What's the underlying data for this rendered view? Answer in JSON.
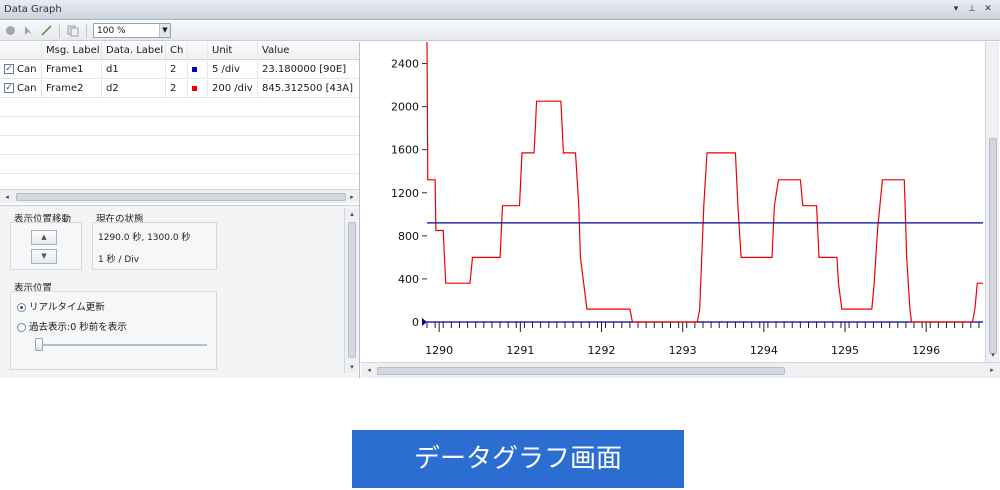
{
  "window": {
    "title": "Data Graph"
  },
  "toolbar": {
    "zoom_value": "100 %"
  },
  "table": {
    "columns": [
      "Msg. Label",
      "Data. Label",
      "Ch",
      "Unit",
      "Value"
    ],
    "rows": [
      {
        "checked": true,
        "bus": "Can",
        "msg": "Frame1",
        "data": "d1",
        "ch": "2",
        "color": "#0000cc",
        "unit": "5 /div",
        "value": "23.180000 [90E]"
      },
      {
        "checked": true,
        "bus": "Can",
        "msg": "Frame2",
        "data": "d2",
        "ch": "2",
        "color": "#ee0000",
        "unit": "200 /div",
        "value": "845.312500 [43A]"
      }
    ]
  },
  "controls": {
    "move_group_label": "表示位置移動",
    "state_group_label": "現在の状態",
    "state_range": "1290.0 秒, 1300.0 秒",
    "state_div": "1 秒 / Div",
    "position_group_label": "表示位置",
    "realtime_option": "リアルタイム更新",
    "past_option": "過去表示:0 秒前を表示"
  },
  "chart_data": {
    "type": "line",
    "xlim": [
      1289.85,
      1296.7
    ],
    "ylim": [
      0,
      2600
    ],
    "x_ticks": [
      "1290",
      "1291",
      "1292",
      "1293",
      "1294",
      "1295",
      "1296"
    ],
    "y_ticks": [
      "0",
      "400",
      "800",
      "1200",
      "1600",
      "2000",
      "2400"
    ],
    "series": [
      {
        "color": "#ee0000",
        "points": [
          [
            1289.85,
            2600
          ],
          [
            1289.86,
            1320
          ],
          [
            1289.95,
            1320
          ],
          [
            1289.96,
            850
          ],
          [
            1290.05,
            850
          ],
          [
            1290.08,
            360
          ],
          [
            1290.38,
            360
          ],
          [
            1290.41,
            600
          ],
          [
            1290.75,
            600
          ],
          [
            1290.78,
            1080
          ],
          [
            1290.99,
            1080
          ],
          [
            1291.02,
            1570
          ],
          [
            1291.17,
            1570
          ],
          [
            1291.2,
            2050
          ],
          [
            1291.5,
            2050
          ],
          [
            1291.53,
            1570
          ],
          [
            1291.68,
            1570
          ],
          [
            1291.72,
            1080
          ],
          [
            1291.74,
            600
          ],
          [
            1291.78,
            360
          ],
          [
            1291.82,
            120
          ],
          [
            1292.35,
            120
          ],
          [
            1292.38,
            0
          ],
          [
            1293.18,
            0
          ],
          [
            1293.21,
            120
          ],
          [
            1293.26,
            1080
          ],
          [
            1293.3,
            1570
          ],
          [
            1293.65,
            1570
          ],
          [
            1293.68,
            1080
          ],
          [
            1293.72,
            600
          ],
          [
            1294.1,
            600
          ],
          [
            1294.13,
            1080
          ],
          [
            1294.18,
            1320
          ],
          [
            1294.45,
            1320
          ],
          [
            1294.48,
            1080
          ],
          [
            1294.65,
            1080
          ],
          [
            1294.68,
            600
          ],
          [
            1294.9,
            600
          ],
          [
            1294.92,
            360
          ],
          [
            1294.96,
            120
          ],
          [
            1295.33,
            120
          ],
          [
            1295.36,
            360
          ],
          [
            1295.4,
            850
          ],
          [
            1295.46,
            1320
          ],
          [
            1295.73,
            1320
          ],
          [
            1295.76,
            600
          ],
          [
            1295.8,
            120
          ],
          [
            1295.82,
            0
          ],
          [
            1296.57,
            0
          ],
          [
            1296.6,
            120
          ],
          [
            1296.63,
            360
          ],
          [
            1296.7,
            360
          ]
        ]
      },
      {
        "color": "#000099",
        "points": [
          [
            1289.85,
            920
          ],
          [
            1296.7,
            920
          ]
        ]
      }
    ]
  },
  "caption": "データグラフ画面"
}
